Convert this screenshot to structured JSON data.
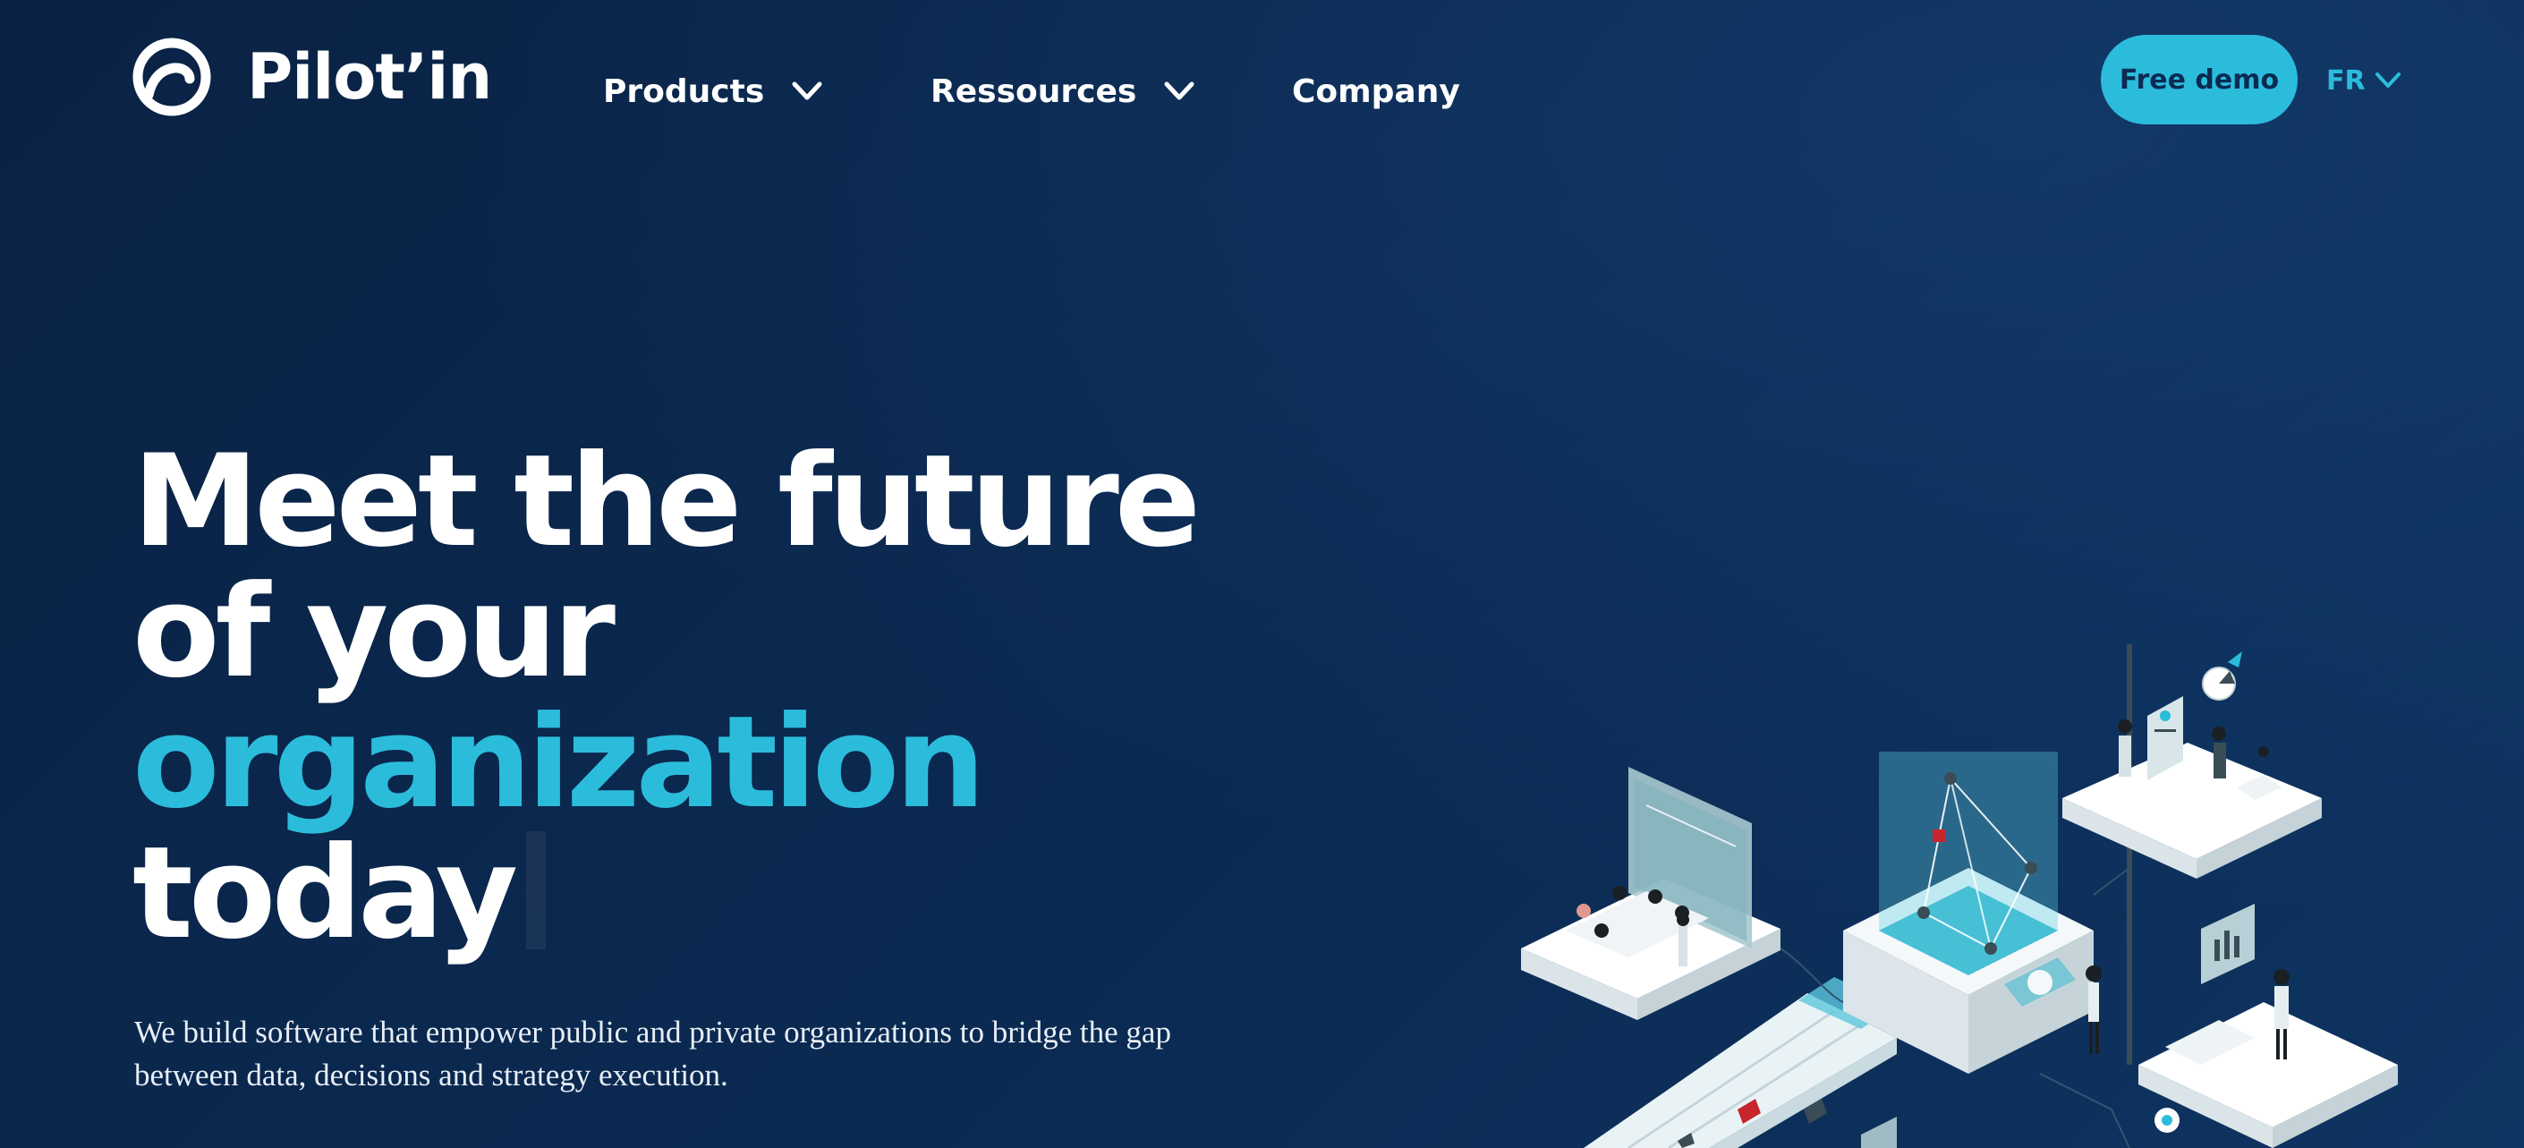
{
  "brand": {
    "name": "Pilot’in",
    "logo_icon": "pilotin-logo-icon"
  },
  "nav": {
    "items": [
      {
        "label": "Products",
        "has_dropdown": true,
        "icon": "chevron-down-icon"
      },
      {
        "label": "Ressources",
        "has_dropdown": true,
        "icon": "chevron-down-icon"
      },
      {
        "label": "Company",
        "has_dropdown": false
      }
    ],
    "cta_label": "Free demo",
    "language": "FR",
    "language_icon": "chevron-down-icon"
  },
  "hero": {
    "title_line1": "Meet the future",
    "title_line2": "of your",
    "title_accent": "organization",
    "title_line4": "today",
    "subtitle": "We build software that empower public and private organizations to bridge the gap between data, decisions and strategy execution."
  },
  "colors": {
    "background": "#0b2a52",
    "accent": "#2bbcdc",
    "text": "#ffffff"
  }
}
